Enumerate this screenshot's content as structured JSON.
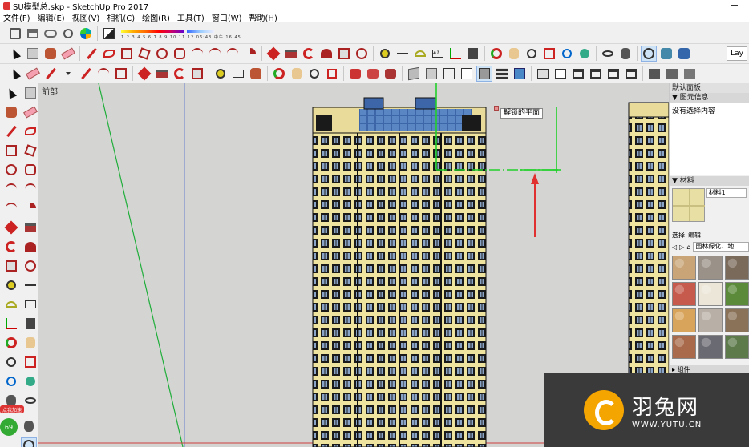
{
  "window": {
    "title": "SU模型总.skp - SketchUp Pro 2017"
  },
  "menu": [
    "文件(F)",
    "编辑(E)",
    "视图(V)",
    "相机(C)",
    "绘图(R)",
    "工具(T)",
    "窗口(W)",
    "帮助(H)"
  ],
  "toolbar": {
    "shadow_numbers": "1 2 3 4 5 6 7 8 9 10 11 12",
    "shadow_time_left": "06:43",
    "shadow_mid": "中午",
    "shadow_time_right": "16:45",
    "layer_label": "Lay"
  },
  "viewport": {
    "scene_tab": "前部",
    "tooltip": "解锁的平面"
  },
  "left_toolbar": {
    "speed_badge": "点我加速",
    "number_badge": "69"
  },
  "right_panel": {
    "tray_title": "默认面板",
    "entity_info_header": "图元信息",
    "entity_info_body": "没有选择内容",
    "materials_header": "材料",
    "material_name": "材料1",
    "tab_select": "选择",
    "tab_edit": "编辑",
    "library": "园林绿化、地",
    "components_header": "组件"
  },
  "textures": [
    "#c8a476",
    "#9a9288",
    "#7a6a5a",
    "#c65a4c",
    "#ece6d8",
    "#5a8a3a",
    "#d8a45c",
    "#b8b0a6",
    "#8a7258",
    "#a86a4a",
    "#6a6a72",
    "#5c7a4a"
  ],
  "watermark": {
    "brand": "羽兔网",
    "url": "WWW.YUTU.CN"
  }
}
